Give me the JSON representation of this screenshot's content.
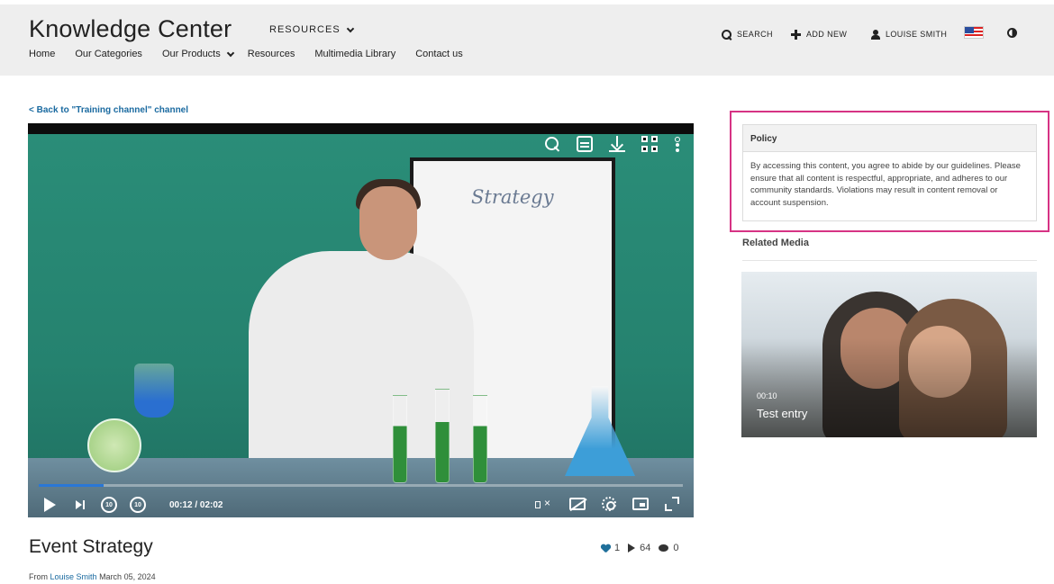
{
  "header": {
    "brand": "Knowledge Center",
    "resources_menu": "RESOURCES",
    "nav": {
      "home": "Home",
      "categories": "Our Categories",
      "products": "Our Products",
      "resources": "Resources",
      "multimedia": "Multimedia Library",
      "contact": "Contact us"
    },
    "actions": {
      "search": "SEARCH",
      "add_new": "ADD NEW",
      "user": "LOUISE SMITH"
    }
  },
  "back_link": "< Back to \"Training channel\" channel",
  "player": {
    "board_text": "Strategy",
    "time": "00:12 / 02:02",
    "progress": 0.1,
    "skip_back": "10",
    "skip_forward": "10"
  },
  "media": {
    "title": "Event Strategy",
    "likes": "1",
    "views": "64",
    "comments": "0",
    "from_label": "From",
    "author": "Louise Smith",
    "date": "March 05, 2024"
  },
  "policy": {
    "heading": "Policy",
    "body": "By accessing this content, you agree to abide by our guidelines. Please ensure that all content is respectful, appropriate, and adheres to our community standards. Violations may result in content removal or account suspension.",
    "highlight_color": "#d63384"
  },
  "related": {
    "heading": "Related Media",
    "items": [
      {
        "duration": "00:10",
        "title": "Test entry"
      }
    ]
  },
  "colors": {
    "link": "#1a6aa0",
    "header_bg": "#eeeeee",
    "progress": "#2a77d6"
  }
}
